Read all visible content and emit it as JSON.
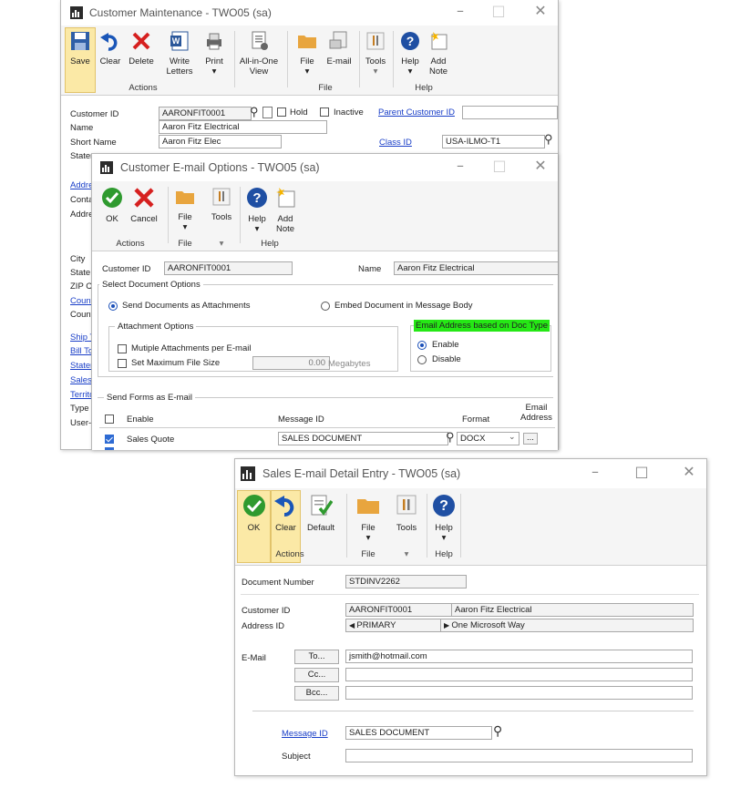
{
  "cm": {
    "title": "Customer Maintenance  -  TWO05 (sa)",
    "ribbon": {
      "save": "Save",
      "clear": "Clear",
      "delete": "Delete",
      "write_letters": "Write\nLetters",
      "print": "Print",
      "all_in_one": "All-in-One\nView",
      "file": "File",
      "email": "E-mail",
      "tools": "Tools",
      "help": "Help",
      "add_note": "Add\nNote"
    },
    "groups": {
      "actions": "Actions",
      "file": "File",
      "help": "Help"
    },
    "labels": {
      "customer_id": "Customer ID",
      "name": "Name",
      "short_name": "Short Name",
      "statement": "Statem",
      "hold": "Hold",
      "inactive": "Inactive",
      "parent_customer_id": "Parent Customer ID",
      "class_id": "Class ID"
    },
    "values": {
      "customer_id": "AARONFIT0001",
      "name": "Aaron Fitz Electrical",
      "short_name": "Aaron Fitz Elec",
      "class_id": "USA-ILMO-T1"
    },
    "side_labels": [
      "Addre",
      "Conta",
      "Addre",
      "City",
      "State",
      "ZIP C",
      "Count",
      "Count",
      "Ship T",
      "Bill To",
      "Staten",
      "Salesp",
      "Territo",
      "Type",
      "User-"
    ]
  },
  "ceo": {
    "title": "Customer E-mail Options  -  TWO05 (sa)",
    "ribbon": {
      "ok": "OK",
      "cancel": "Cancel",
      "file": "File",
      "tools": "Tools",
      "help": "Help",
      "add_note": "Add\nNote"
    },
    "groups": {
      "actions": "Actions",
      "file": "File",
      "help": "Help"
    },
    "customer_id_label": "Customer ID",
    "customer_id": "AARONFIT0001",
    "name_label": "Name",
    "name": "Aaron Fitz Electrical",
    "select_doc_options": "Select Document Options",
    "send_as_attachments": "Send Documents as Attachments",
    "embed_in_body": "Embed Document in Message Body",
    "attachment_options": "Attachment Options",
    "multiple_attachments": "Mutiple Attachments per E-mail",
    "set_max_file_size": "Set Maximum File Size",
    "max_size_value": "0.00",
    "megabytes": "Megabytes",
    "email_based_on_doc": "Email Address based on Doc Type",
    "enable": "Enable",
    "disable": "Disable",
    "send_forms": "Send Forms as E-mail",
    "col_enable": "Enable",
    "col_message_id": "Message ID",
    "col_format": "Format",
    "col_email_address": "Email\nAddress",
    "row_name": "Sales Quote",
    "row_message_id": "SALES DOCUMENT",
    "row_format": "DOCX"
  },
  "sed": {
    "title": "Sales E-mail Detail Entry  -  TWO05 (sa)",
    "ribbon": {
      "ok": "OK",
      "clear": "Clear",
      "default": "Default",
      "file": "File",
      "tools": "Tools",
      "help": "Help"
    },
    "groups": {
      "actions": "Actions",
      "file": "File",
      "help": "Help"
    },
    "document_number_label": "Document Number",
    "document_number": "STDINV2262",
    "customer_id_label": "Customer ID",
    "customer_id": "AARONFIT0001",
    "customer_name": "Aaron Fitz Electrical",
    "address_id_label": "Address ID",
    "address_id": "PRIMARY",
    "address": "One Microsoft Way",
    "email_label": "E-Mail",
    "to_button": "To...",
    "cc_button": "Cc...",
    "bcc_button": "Bcc...",
    "to_value": "jsmith@hotmail.com",
    "message_id_label": "Message ID",
    "message_id": "SALES DOCUMENT",
    "subject_label": "Subject"
  },
  "colors": {
    "highlight": "#25e815",
    "link": "#1a3fc8",
    "accent": "#3a6ea5"
  }
}
